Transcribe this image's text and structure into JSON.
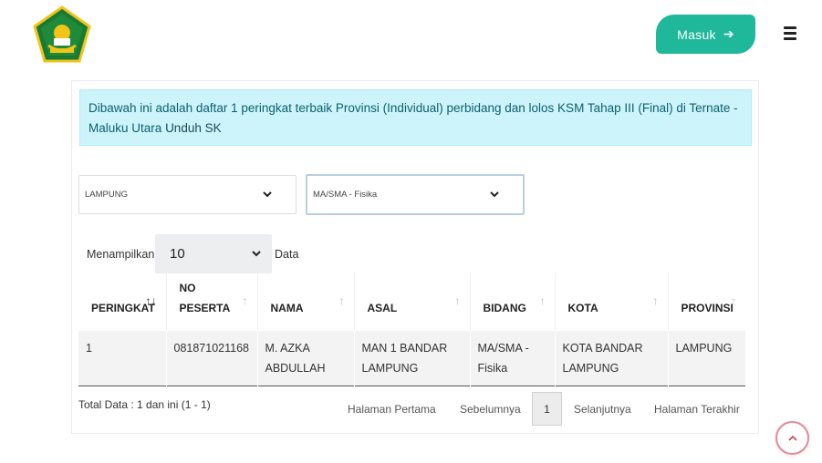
{
  "header": {
    "login_label": "Masuk",
    "login_icon": "arrow-right-icon",
    "menu_icon": "hamburger-menu-icon",
    "logo_icon": "kemenag-logo",
    "brand_colors": {
      "accent": "#1fb89a",
      "logo_green": "#1a7a33",
      "logo_gold": "#f0c419"
    }
  },
  "alert": {
    "text": "Dibawah ini adalah daftar 1 peringkat terbaik Provinsi (Individual) perbidang dan lolos KSM Tahap III (Final) di Ternate - Maluku Utara",
    "link_label": "Unduh SK"
  },
  "filters": {
    "provinsi_selected": "LAMPUNG",
    "bidang_selected": "MA/SMA - Fisika"
  },
  "length": {
    "prefix": "Menampilkan",
    "value": "10",
    "suffix": "Data"
  },
  "table": {
    "columns": [
      {
        "label": "PERINGKAT",
        "sort": "↑↓"
      },
      {
        "label": "NO PESERTA",
        "sort": "↑"
      },
      {
        "label": "NAMA",
        "sort": "↑"
      },
      {
        "label": "ASAL",
        "sort": "↑"
      },
      {
        "label": "BIDANG",
        "sort": "↑"
      },
      {
        "label": "KOTA",
        "sort": "↑"
      },
      {
        "label": "PROVINSI",
        "sort": "↑"
      }
    ],
    "rows": [
      [
        "1",
        "081871021168",
        "M. AZKA ABDULLAH",
        "MAN 1 BANDAR LAMPUNG",
        "MA/SMA - Fisika",
        "KOTA BANDAR LAMPUNG",
        "LAMPUNG"
      ]
    ]
  },
  "footer": {
    "total_text": "Total Data : 1 dan ini (1 - 1)",
    "first": "Halaman Pertama",
    "prev": "Sebelumnya",
    "current_page": "1",
    "next": "Selanjutnya",
    "last": "Halaman Terakhir"
  },
  "scroll_top_icon": "chevron-up-icon"
}
